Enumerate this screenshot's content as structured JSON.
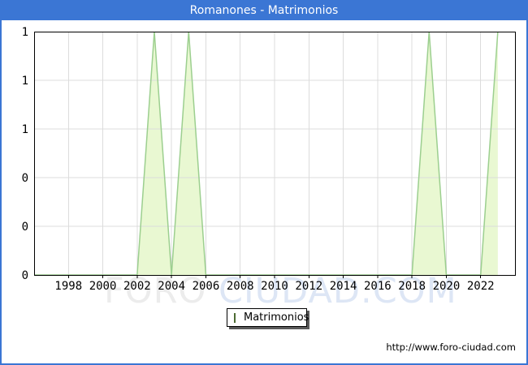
{
  "title": "Romanones - Matrimonios",
  "watermark": {
    "part1": "FORO",
    "part2": " CIUDAD.COM"
  },
  "legend": {
    "label": "Matrimonios"
  },
  "footer": {
    "url": "http://www.foro-ciudad.com"
  },
  "colors": {
    "titlebar_bg": "#3b76d4",
    "titlebar_text": "#ffffff",
    "frame_border": "#3b76d4",
    "plot_frame": "#000000",
    "grid": "#dcdcdc",
    "area_fill": "#e9f8d2",
    "area_stroke": "#9ccf8f",
    "legend_swatch_fill": "#c6e99b",
    "legend_swatch_border": "#4c6b33",
    "watermark_gray": "#ececec",
    "watermark_blue": "#dde6f5",
    "text": "#000000"
  },
  "chart_data": {
    "type": "area",
    "title": "Romanones - Matrimonios",
    "series": [
      {
        "name": "Matrimonios",
        "x": [
          1996,
          1997,
          1998,
          1999,
          2000,
          2001,
          2002,
          2003,
          2004,
          2005,
          2006,
          2007,
          2008,
          2009,
          2010,
          2011,
          2012,
          2013,
          2014,
          2015,
          2016,
          2017,
          2018,
          2019,
          2020,
          2021,
          2022,
          2023
        ],
        "values": [
          0,
          0,
          0,
          0,
          0,
          0,
          0,
          1,
          0,
          1,
          0,
          0,
          0,
          0,
          0,
          0,
          0,
          0,
          0,
          0,
          0,
          0,
          0,
          1,
          0,
          0,
          0,
          1
        ]
      }
    ],
    "xlim": [
      1996,
      2024
    ],
    "ylim": [
      0,
      1
    ],
    "x_ticks": [
      1998,
      2000,
      2002,
      2004,
      2006,
      2008,
      2010,
      2012,
      2014,
      2016,
      2018,
      2020,
      2022
    ],
    "y_ticks": {
      "values": [
        0,
        0.2,
        0.4,
        0.6,
        0.8,
        1
      ],
      "labels": [
        "0",
        "0",
        "0",
        "1",
        "1",
        "1"
      ]
    },
    "grid": true,
    "legend_position": "bottom-center"
  }
}
